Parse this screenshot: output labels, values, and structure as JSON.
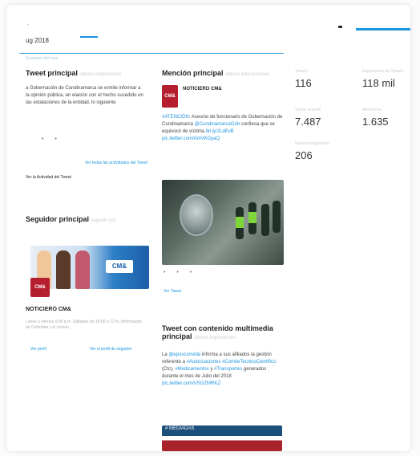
{
  "header": {
    "top_mark": "-",
    "month": "ug 2018",
    "blur_link": "Resumen del mes"
  },
  "top_tweet": {
    "title": "Tweet principal",
    "title_meta": "obtuvo impresiones",
    "body": "a Gobernación de Cundinamarca se ermite informar a la opinión pública, en elación con el hecho sucedido en las estalaciones de la entidad, lo siguiente",
    "view_all": "Ver todas las actividades del Tweet",
    "activity_link": "Ver la Actividad del Tweet"
  },
  "top_mention": {
    "title": "Mención principal",
    "title_meta": "obtuvo interacciones",
    "author": "NOTICIERO CM&",
    "avatar_text": "CM&",
    "body_prefix": "#ATENCIÓN",
    "body_1": ": Asesino de funcionario de Gobernación de Cundinamarca",
    "mention": "@CundinamarcaGob",
    "body_2": " confiesa que se equivocó de víctima ",
    "link": "bit.ly/2LdEvB",
    "link2": "pic.twitter.com/AmVKDyaQ",
    "view": "Ver Tweet"
  },
  "top_follower": {
    "title": "Seguidor principal",
    "title_meta": "seguido por",
    "name": "NOTICIERO CM&",
    "avatar_text": "CM&",
    "bio": "Lunes a viernes 9:00 p.m. Sábados de 10:00 a 12 m. Información de Colombia y el mundo.",
    "follow_link": "Ver perfil",
    "view_profile": "Ver el perfil de seguidor",
    "banner_logo": "CM&"
  },
  "top_media_tweet": {
    "title_line1": "Tweet con contenido multimedia",
    "title_line2": "principal",
    "title_meta": "obtuvo impresiones",
    "mention": "@eposconvida",
    "body_1": " informa a sus afiliados la gestión referente a ",
    "hashtag1": "#Autorizaciones",
    "hashtag2": "#ComiteTecnicoCientifico",
    "body_2": " (Ctc), ",
    "hashtag3": "#Medicamentos",
    "body_3": " y ",
    "hashtag4": "#Transportes",
    "body_4": " generados durante el mes de Julio del 2018",
    "link": "pic.twitter.com/VSGZMRKZ",
    "image_text": "# MEDIADAS"
  },
  "stats": [
    {
      "label": "Tweets",
      "value": "116"
    },
    {
      "label": "Impresiones de Tweets",
      "value": "118 mil"
    },
    {
      "label": "Visitas al perfil",
      "value": "7.487"
    },
    {
      "label": "Menciones",
      "value": "1.635"
    },
    {
      "label": "Nuevos seguidores",
      "value": "206"
    }
  ],
  "colors": {
    "accent": "#1b95e0",
    "brand_red": "#b41e2e"
  }
}
